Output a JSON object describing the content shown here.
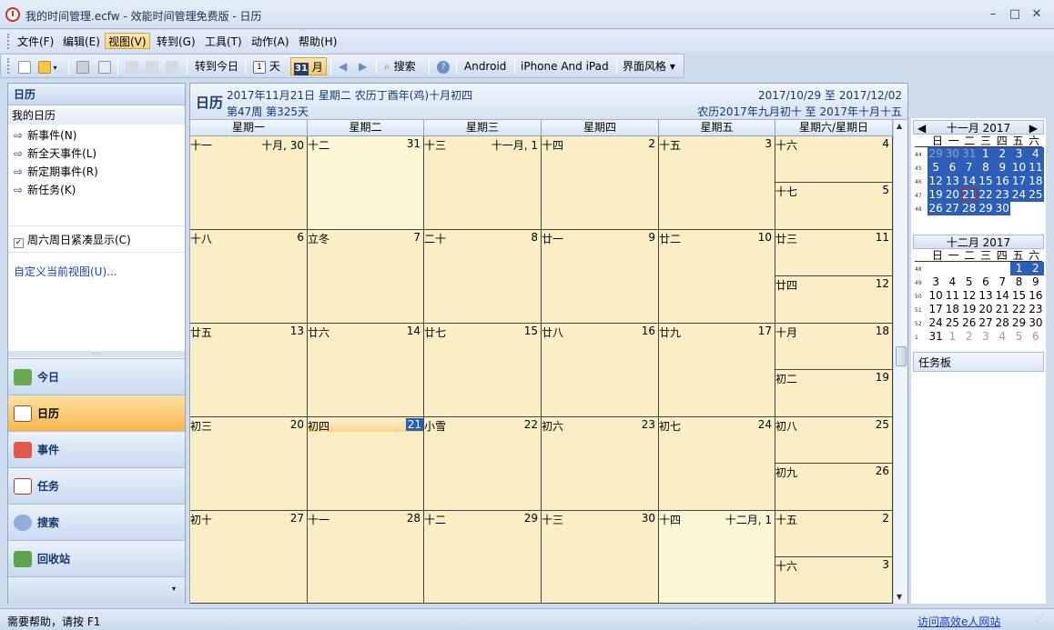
{
  "window": {
    "title": "我的时间管理.ecfw - 效能时间管理免费版 - 日历",
    "min": "–",
    "max": "□",
    "close": "✕"
  },
  "menu": [
    "文件(F)",
    "编辑(E)",
    "视图(V)",
    "转到(G)",
    "工具(T)",
    "动作(A)",
    "帮助(H)"
  ],
  "toolbar": {
    "goto_today": "转到今日",
    "day_label": "天",
    "month_icon": "31",
    "month_label": "月",
    "search": "搜索",
    "android": "Android",
    "iphone": "iPhone And iPad",
    "skin": "界面风格 ▾"
  },
  "left": {
    "header": "日历",
    "my_calendar": "我的日历",
    "tasks": [
      "新事件(N)",
      "新全天事件(L)",
      "新定期事件(R)",
      "新任务(K)"
    ],
    "compact": "周六周日紧凑显示(C)",
    "custom_view": "自定义当前视图(U)...",
    "nav": [
      "今日",
      "日历",
      "事件",
      "任务",
      "搜索",
      "回收站"
    ]
  },
  "calendar": {
    "title": "日历",
    "date_line": "2017年11月21日 星期二 农历丁酉年(鸡)十月初四",
    "week_line": "第47周 第325天",
    "range": "2017/10/29 至 2017/12/02",
    "lunar_range": "农历2017年九月初十 至 2017年十月十五",
    "weekdays": [
      "星期一",
      "星期二",
      "星期三",
      "星期四",
      "星期五",
      "星期六/星期日"
    ],
    "weeks": [
      {
        "days": [
          [
            "十一",
            "十月, 30"
          ],
          [
            "十二",
            "31"
          ],
          [
            "十三",
            "十一月, 1"
          ],
          [
            "十四",
            "2"
          ],
          [
            "十五",
            "3"
          ]
        ],
        "sat": [
          "十六",
          "4"
        ],
        "sun": [
          "十七",
          "5"
        ]
      },
      {
        "days": [
          [
            "十八",
            "6"
          ],
          [
            "立冬",
            "7"
          ],
          [
            "二十",
            "8"
          ],
          [
            "廿一",
            "9"
          ],
          [
            "廿二",
            "10"
          ]
        ],
        "sat": [
          "廿三",
          "11"
        ],
        "sun": [
          "廿四",
          "12"
        ]
      },
      {
        "days": [
          [
            "廿五",
            "13"
          ],
          [
            "廿六",
            "14"
          ],
          [
            "廿七",
            "15"
          ],
          [
            "廿八",
            "16"
          ],
          [
            "廿九",
            "17"
          ]
        ],
        "sat": [
          "十月",
          "18"
        ],
        "sun": [
          "初二",
          "19"
        ]
      },
      {
        "days": [
          [
            "初三",
            "20"
          ],
          [
            "初四",
            "21"
          ],
          [
            "小雪",
            "22"
          ],
          [
            "初六",
            "23"
          ],
          [
            "初七",
            "24"
          ]
        ],
        "sat": [
          "初八",
          "25"
        ],
        "sun": [
          "初九",
          "26"
        ]
      },
      {
        "days": [
          [
            "初十",
            "27"
          ],
          [
            "十一",
            "28"
          ],
          [
            "十二",
            "29"
          ],
          [
            "十三",
            "30"
          ],
          [
            "十四",
            "十二月, 1"
          ]
        ],
        "sat": [
          "十五",
          "2"
        ],
        "sun": [
          "十六",
          "3"
        ]
      }
    ]
  },
  "mini_nov": {
    "title": "十一月 2017",
    "weekdays": [
      "日",
      "一",
      "二",
      "三",
      "四",
      "五",
      "六"
    ],
    "rows": [
      {
        "wk": "44",
        "days": [
          "29",
          "30",
          "31",
          "1",
          "2",
          "3",
          "4"
        ]
      },
      {
        "wk": "45",
        "days": [
          "5",
          "6",
          "7",
          "8",
          "9",
          "10",
          "11"
        ]
      },
      {
        "wk": "46",
        "days": [
          "12",
          "13",
          "14",
          "15",
          "16",
          "17",
          "18"
        ]
      },
      {
        "wk": "47",
        "days": [
          "19",
          "20",
          "21",
          "22",
          "23",
          "24",
          "25"
        ]
      },
      {
        "wk": "48",
        "days": [
          "26",
          "27",
          "28",
          "29",
          "30",
          "",
          ""
        ]
      }
    ]
  },
  "mini_dec": {
    "title": "十二月 2017",
    "weekdays": [
      "日",
      "一",
      "二",
      "三",
      "四",
      "五",
      "六"
    ],
    "rows": [
      {
        "wk": "48",
        "days": [
          "",
          "",
          "",
          "",
          "",
          "1",
          "2"
        ]
      },
      {
        "wk": "49",
        "days": [
          "3",
          "4",
          "5",
          "6",
          "7",
          "8",
          "9"
        ]
      },
      {
        "wk": "50",
        "days": [
          "10",
          "11",
          "12",
          "13",
          "14",
          "15",
          "16"
        ]
      },
      {
        "wk": "51",
        "days": [
          "17",
          "18",
          "19",
          "20",
          "21",
          "22",
          "23"
        ]
      },
      {
        "wk": "52",
        "days": [
          "24",
          "25",
          "26",
          "27",
          "28",
          "29",
          "30"
        ]
      },
      {
        "wk": "1",
        "days": [
          "31",
          "1",
          "2",
          "3",
          "4",
          "5",
          "6"
        ]
      }
    ]
  },
  "task_board": "任务板",
  "status": {
    "help": "需要帮助，请按 F1",
    "link": "访问高效e人网站"
  },
  "colors": {
    "accent": "#2d5eb8",
    "today_red": "#d02020",
    "cell": "#fbeec4"
  }
}
